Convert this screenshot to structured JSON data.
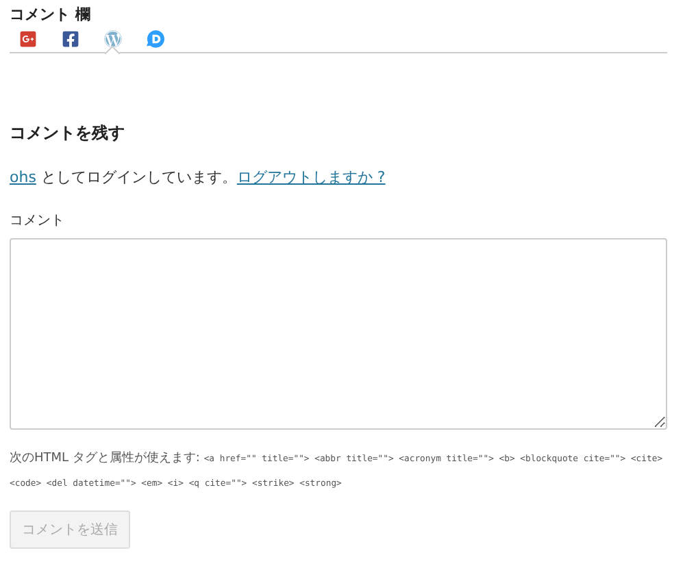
{
  "section_title": "コメント 欄",
  "login_tabs": [
    {
      "kind": "googleplus",
      "selected": false
    },
    {
      "kind": "facebook",
      "selected": false
    },
    {
      "kind": "wordpress",
      "selected": true
    },
    {
      "kind": "disqus",
      "selected": false
    }
  ],
  "form": {
    "heading": "コメントを残す",
    "login": {
      "user": "ohs",
      "text": "としてログインしています。",
      "logout": "ログアウトしますか ?"
    },
    "comment_label": "コメント",
    "allowed_intro": "次のHTML タグと属性が使えます: ",
    "allowed_tags": "<a href=\"\" title=\"\"> <abbr title=\"\"> <acronym title=\"\"> <b> <blockquote cite=\"\"> <cite> <code> <del datetime=\"\"> <em> <i> <q cite=\"\"> <strike> <strong>",
    "submit": {
      "label": "コメントを送信",
      "disabled": true
    }
  }
}
